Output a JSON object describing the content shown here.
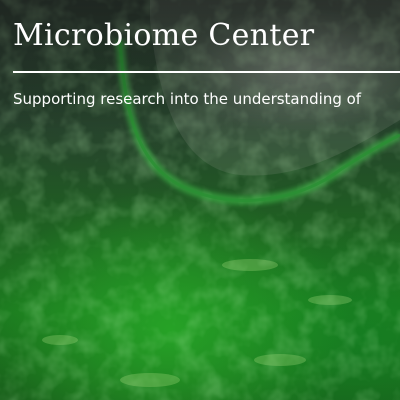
{
  "hero": {
    "title": "Microbiome Center",
    "subtitle": "Supporting research into the understanding of",
    "background_image": "green-microscopy-texture",
    "colors": {
      "text": "#ffffff",
      "accent_green": "#1c7a1f"
    }
  }
}
